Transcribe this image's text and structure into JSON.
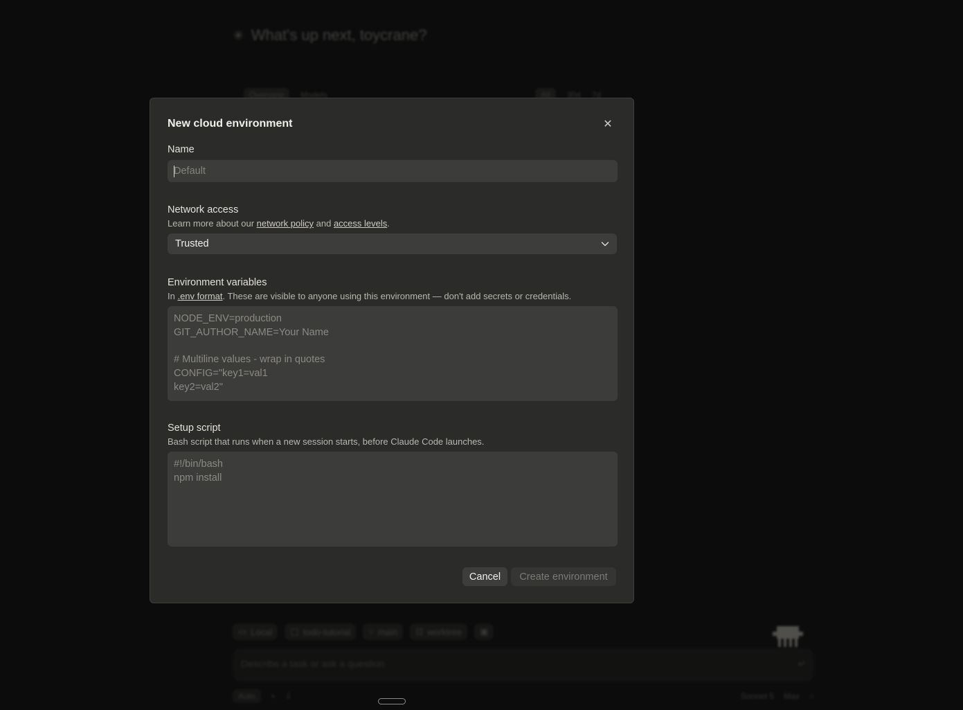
{
  "background": {
    "greeting": "What's up next, toycrane?",
    "tabs_left": [
      "Overview",
      "Models"
    ],
    "tabs_right": [
      "All",
      "30d",
      "7d"
    ],
    "chips": [
      {
        "icon": "monitor-icon",
        "label": "Local"
      },
      {
        "icon": "folder-icon",
        "label": "todo-tutorial"
      },
      {
        "icon": "branch-icon",
        "label": "main"
      },
      {
        "icon": "worktree-icon",
        "label": "worktree"
      },
      {
        "icon": "window-icon",
        "label": ""
      }
    ],
    "prompt_placeholder": "Describe a task or ask a question",
    "footer_left": [
      "Auto",
      "+",
      "⇩"
    ],
    "footer_right": [
      "Sonnet 5",
      "Max"
    ]
  },
  "modal": {
    "title": "New cloud environment",
    "close_icon": "close-icon",
    "name": {
      "label": "Name",
      "placeholder": "Default",
      "value": ""
    },
    "network": {
      "label": "Network access",
      "desc_prefix": "Learn more about our ",
      "link1": "network policy",
      "desc_mid": " and ",
      "link2": "access levels",
      "desc_suffix": ".",
      "selected": "Trusted"
    },
    "env_vars": {
      "label": "Environment variables",
      "desc_prefix": "In ",
      "link": ".env format",
      "desc_suffix": ". These are visible to anyone using this environment — don't add secrets or credentials.",
      "placeholder": "NODE_ENV=production\nGIT_AUTHOR_NAME=Your Name\n\n# Multiline values - wrap in quotes\nCONFIG=\"key1=val1\nkey2=val2\""
    },
    "setup": {
      "label": "Setup script",
      "desc": "Bash script that runs when a new session starts, before Claude Code launches.",
      "placeholder": "#!/bin/bash\nnpm install"
    },
    "buttons": {
      "cancel": "Cancel",
      "create": "Create environment"
    }
  }
}
